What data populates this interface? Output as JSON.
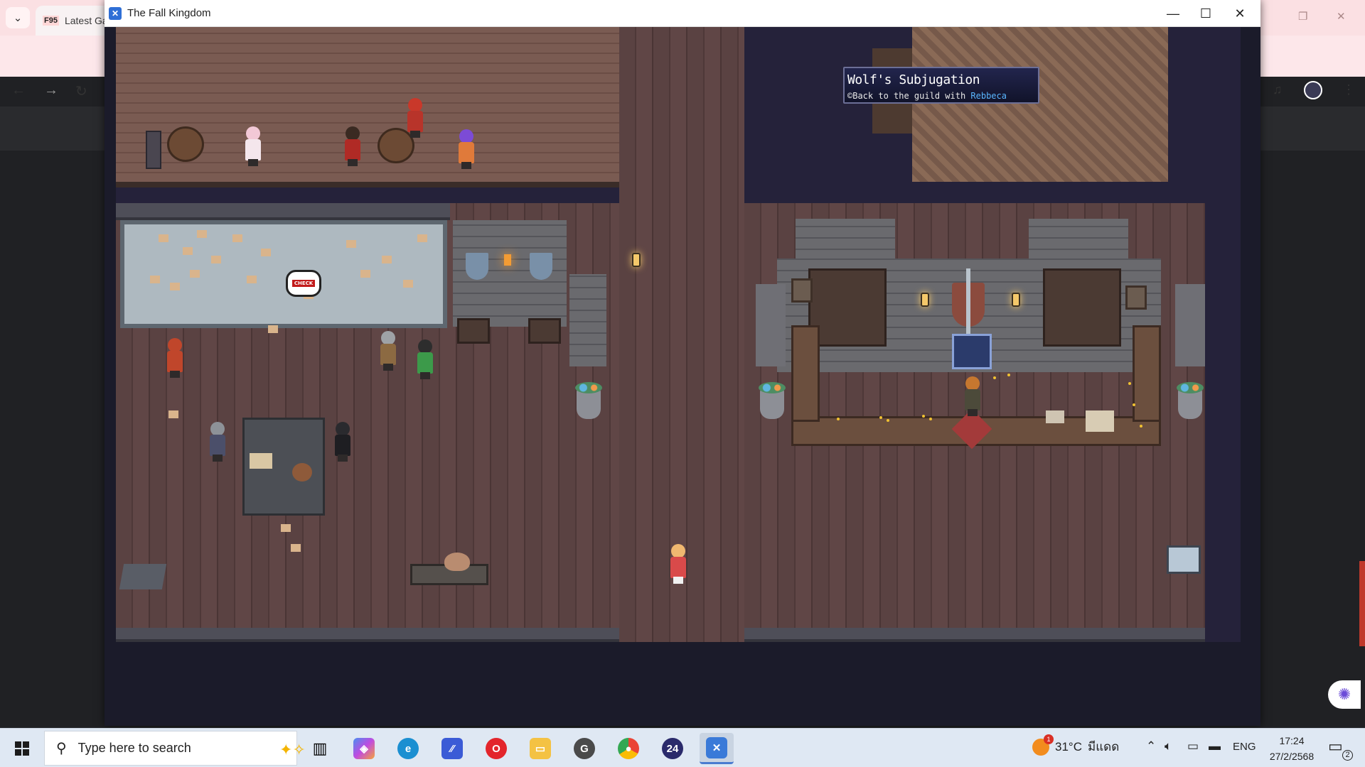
{
  "browser": {
    "tab_title": "Latest Ga",
    "tab_favicon": "F95",
    "icons": [
      "tab-list-icon",
      "back-icon",
      "forward-icon",
      "reload-icon",
      "media-icon",
      "profile-avatar",
      "menu-icon"
    ]
  },
  "game_window": {
    "title": "The Fall Kingdom",
    "controls": {
      "minimize": "—",
      "maximize": "☐",
      "close": "✕"
    },
    "quest": {
      "title": "Wolf's Subjugation",
      "desc_prefix": "©Back to the guild with ",
      "desc_name": "Rebbeca"
    },
    "speech_bubble_label": "CHECK"
  },
  "taskbar": {
    "search_placeholder": "Type here to search",
    "apps": [
      "Task View",
      "Copilot",
      "Edge",
      "Visual Studio",
      "Opera",
      "File Explorer",
      "App",
      "Chrome",
      "24",
      "Game"
    ],
    "weather": {
      "temp": "31°C",
      "condition": "มีแดด",
      "badge": "1"
    },
    "language": "ENG",
    "time": "17:24",
    "date": "27/2/2568",
    "notification_count": "2"
  },
  "colors": {
    "quest_name": "#5ab6ff",
    "taskbar_bg": "#dfe8f3",
    "browser_tabbar": "#fbe0e3"
  }
}
